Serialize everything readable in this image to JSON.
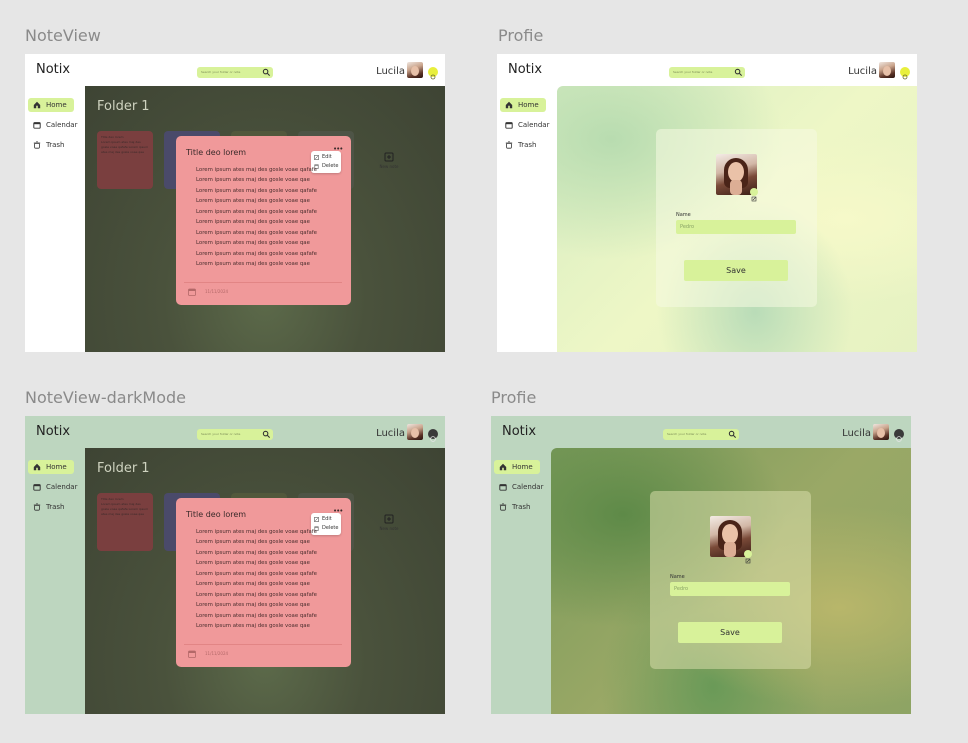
{
  "frames": {
    "noteview": {
      "title": "NoteView",
      "app_name": "Notix",
      "search_placeholder": "Search your folder or note",
      "user_name": "Lucila",
      "nav": {
        "home": "Home",
        "calendar": "Calendar",
        "trash": "Trash"
      },
      "folder_title": "Folder 1",
      "bg_card_title": "Title deo lorem",
      "bg_card_body": "Lorem ipsum ates maj des gosle voae qafafe Lorem ipsum ates maj des gosle voae qae",
      "new_note": "New note",
      "note": {
        "title": "Title deo lorem",
        "menu_edit": "Edit",
        "menu_delete": "Delete",
        "lines": [
          "Lorem ipsum ates maj des gosle voae qafafe",
          "Lorem ipsum ates maj des gosle voae qae",
          "Lorem ipsum ates maj des gosle voae qafafe",
          "Lorem ipsum ates maj des gosle voae qae",
          "Lorem ipsum ates maj des gosle voae qafafe",
          "Lorem ipsum ates maj des gosle voae qae",
          "Lorem ipsum ates maj des gosle voae qafafe",
          "Lorem ipsum ates maj des gosle voae qae",
          "Lorem ipsum ates maj des gosle voae qafafe",
          "Lorem ipsum ates maj des gosle voae qae"
        ],
        "date": "11/11/2024"
      }
    },
    "profile": {
      "title": "Profie",
      "app_name": "Notix",
      "search_placeholder": "Search your folder or note",
      "user_name": "Lucila",
      "nav": {
        "home": "Home",
        "calendar": "Calendar",
        "trash": "Trash"
      },
      "name_label": "Name",
      "name_value": "Pedro",
      "save_label": "Save"
    },
    "noteview_dark": {
      "title": "NoteView-darkMode",
      "app_name": "Notix",
      "search_placeholder": "Search your folder or note",
      "user_name": "Lucila",
      "nav": {
        "home": "Home",
        "calendar": "Calendar",
        "trash": "Trash"
      },
      "folder_title": "Folder 1",
      "bg_card_title": "Title deo lorem",
      "bg_card_body": "Lorem ipsum ates maj des gosle voae qafafe Lorem ipsum ates maj des gosle voae qae",
      "new_note": "New note",
      "note": {
        "title": "Title deo lorem",
        "menu_edit": "Edit",
        "menu_delete": "Delete",
        "lines": [
          "Lorem ipsum ates maj des gosle voae qafafe",
          "Lorem ipsum ates maj des gosle voae qae",
          "Lorem ipsum ates maj des gosle voae qafafe",
          "Lorem ipsum ates maj des gosle voae qae",
          "Lorem ipsum ates maj des gosle voae qafafe",
          "Lorem ipsum ates maj des gosle voae qae",
          "Lorem ipsum ates maj des gosle voae qafafe",
          "Lorem ipsum ates maj des gosle voae qae",
          "Lorem ipsum ates maj des gosle voae qafafe",
          "Lorem ipsum ates maj des gosle voae qae"
        ],
        "date": "11/11/2024"
      }
    },
    "profile_dark": {
      "title": "Profie",
      "app_name": "Notix",
      "search_placeholder": "Search your folder or note",
      "user_name": "Lucila",
      "nav": {
        "home": "Home",
        "calendar": "Calendar",
        "trash": "Trash"
      },
      "name_label": "Name",
      "name_value": "Pedro",
      "save_label": "Save"
    }
  },
  "colors": {
    "canvas": "#e6e6e6",
    "accent_green": "#d8f29a",
    "note_pink": "#f0999a",
    "dark_sidebar": "#bdd6bf",
    "light_toggle": "#e8ef3c",
    "dark_toggle": "#3a3a3a"
  },
  "icons": [
    "home-icon",
    "calendar-icon",
    "trash-icon",
    "search-icon",
    "sun-icon",
    "moon-icon",
    "more-dots-icon",
    "edit-icon",
    "delete-icon",
    "new-note-icon",
    "date-icon",
    "edit-photo-icon"
  ]
}
